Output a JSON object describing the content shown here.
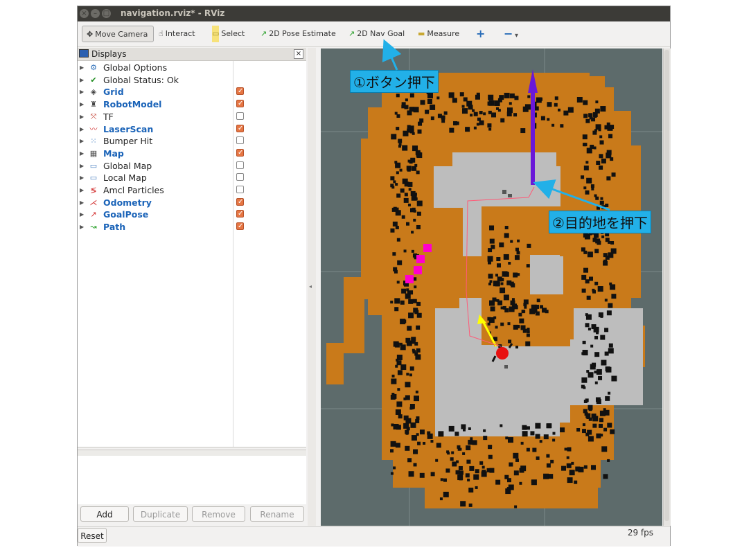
{
  "window": {
    "title": "navigation.rviz* - RViz",
    "controls": [
      "×",
      "–",
      "□"
    ]
  },
  "toolbar": {
    "tools": [
      {
        "label": "Move Camera",
        "icon": "move-camera-icon",
        "glyph": "✥",
        "active": true
      },
      {
        "label": "Interact",
        "icon": "hand-pointer-icon",
        "glyph": "☝",
        "active": false
      },
      {
        "label": "Select",
        "icon": "select-box-icon",
        "glyph": "▭",
        "active": false
      },
      {
        "label": "2D Pose Estimate",
        "icon": "pose-arrow-icon",
        "glyph": "↗",
        "active": false
      },
      {
        "label": "2D Nav Goal",
        "icon": "nav-goal-arrow-icon",
        "glyph": "↗",
        "active": false
      },
      {
        "label": "Measure",
        "icon": "ruler-icon",
        "glyph": "▬",
        "active": false
      }
    ],
    "add_tool": "+",
    "remove_tool": "−",
    "menu_caret": "▾"
  },
  "displays": {
    "title": "Displays",
    "close": "×",
    "items": [
      {
        "label": "Global Options",
        "icon": "gear-icon",
        "glyph": "⚙",
        "icon_color": "#2a6db8",
        "highlight": false,
        "checkbox": null
      },
      {
        "label": "Global Status: Ok",
        "icon": "checkmark-icon",
        "glyph": "✔",
        "icon_color": "#1a8a1a",
        "highlight": false,
        "checkbox": null
      },
      {
        "label": "Grid",
        "icon": "grid-icon",
        "glyph": "◈",
        "icon_color": "#444444",
        "highlight": true,
        "checkbox": true
      },
      {
        "label": "RobotModel",
        "icon": "robot-icon",
        "glyph": "♜",
        "icon_color": "#444444",
        "highlight": true,
        "checkbox": true
      },
      {
        "label": "TF",
        "icon": "tf-axes-icon",
        "glyph": "⤧",
        "icon_color": "#c0392b",
        "highlight": false,
        "checkbox": false
      },
      {
        "label": "LaserScan",
        "icon": "laser-scan-icon",
        "glyph": "〰",
        "icon_color": "#d32f2f",
        "highlight": true,
        "checkbox": true
      },
      {
        "label": "Bumper Hit",
        "icon": "point-cloud-icon",
        "glyph": "⁙",
        "icon_color": "#2a6db8",
        "highlight": false,
        "checkbox": false
      },
      {
        "label": "Map",
        "icon": "map-icon",
        "glyph": "▦",
        "icon_color": "#555555",
        "highlight": true,
        "checkbox": true
      },
      {
        "label": "Global Map",
        "icon": "folder-icon",
        "glyph": "▭",
        "icon_color": "#4a7fc0",
        "highlight": false,
        "checkbox": false
      },
      {
        "label": "Local Map",
        "icon": "folder-icon",
        "glyph": "▭",
        "icon_color": "#4a7fc0",
        "highlight": false,
        "checkbox": false
      },
      {
        "label": "Amcl Particles",
        "icon": "particles-icon",
        "glyph": "≶",
        "icon_color": "#d32f2f",
        "highlight": false,
        "checkbox": false
      },
      {
        "label": "Odometry",
        "icon": "odometry-icon",
        "glyph": "⋌",
        "icon_color": "#d32f2f",
        "highlight": true,
        "checkbox": true
      },
      {
        "label": "GoalPose",
        "icon": "goal-pose-icon",
        "glyph": "↗",
        "icon_color": "#d32f2f",
        "highlight": true,
        "checkbox": true
      },
      {
        "label": "Path",
        "icon": "path-icon",
        "glyph": "↝",
        "icon_color": "#1a9a1a",
        "highlight": true,
        "checkbox": true
      }
    ],
    "buttons": {
      "add": "Add",
      "duplicate": "Duplicate",
      "remove": "Remove",
      "rename": "Rename"
    }
  },
  "status": {
    "reset": "Reset",
    "fps": "29 fps"
  },
  "annotations": {
    "step1": "①ボタン押下",
    "step2": "②目的地を押下"
  },
  "colors": {
    "map_background": "#5d6b6b",
    "inflation": "#c97a1a",
    "free_space": "#bdbdbd",
    "obstacle": "#111111",
    "robot": "#e81010",
    "goal_arrow": "#6a18d8",
    "pose_arrow": "#ffff00",
    "particles": "#ff00cc",
    "path": "#ff5a78",
    "callout": "#22b0e8"
  }
}
